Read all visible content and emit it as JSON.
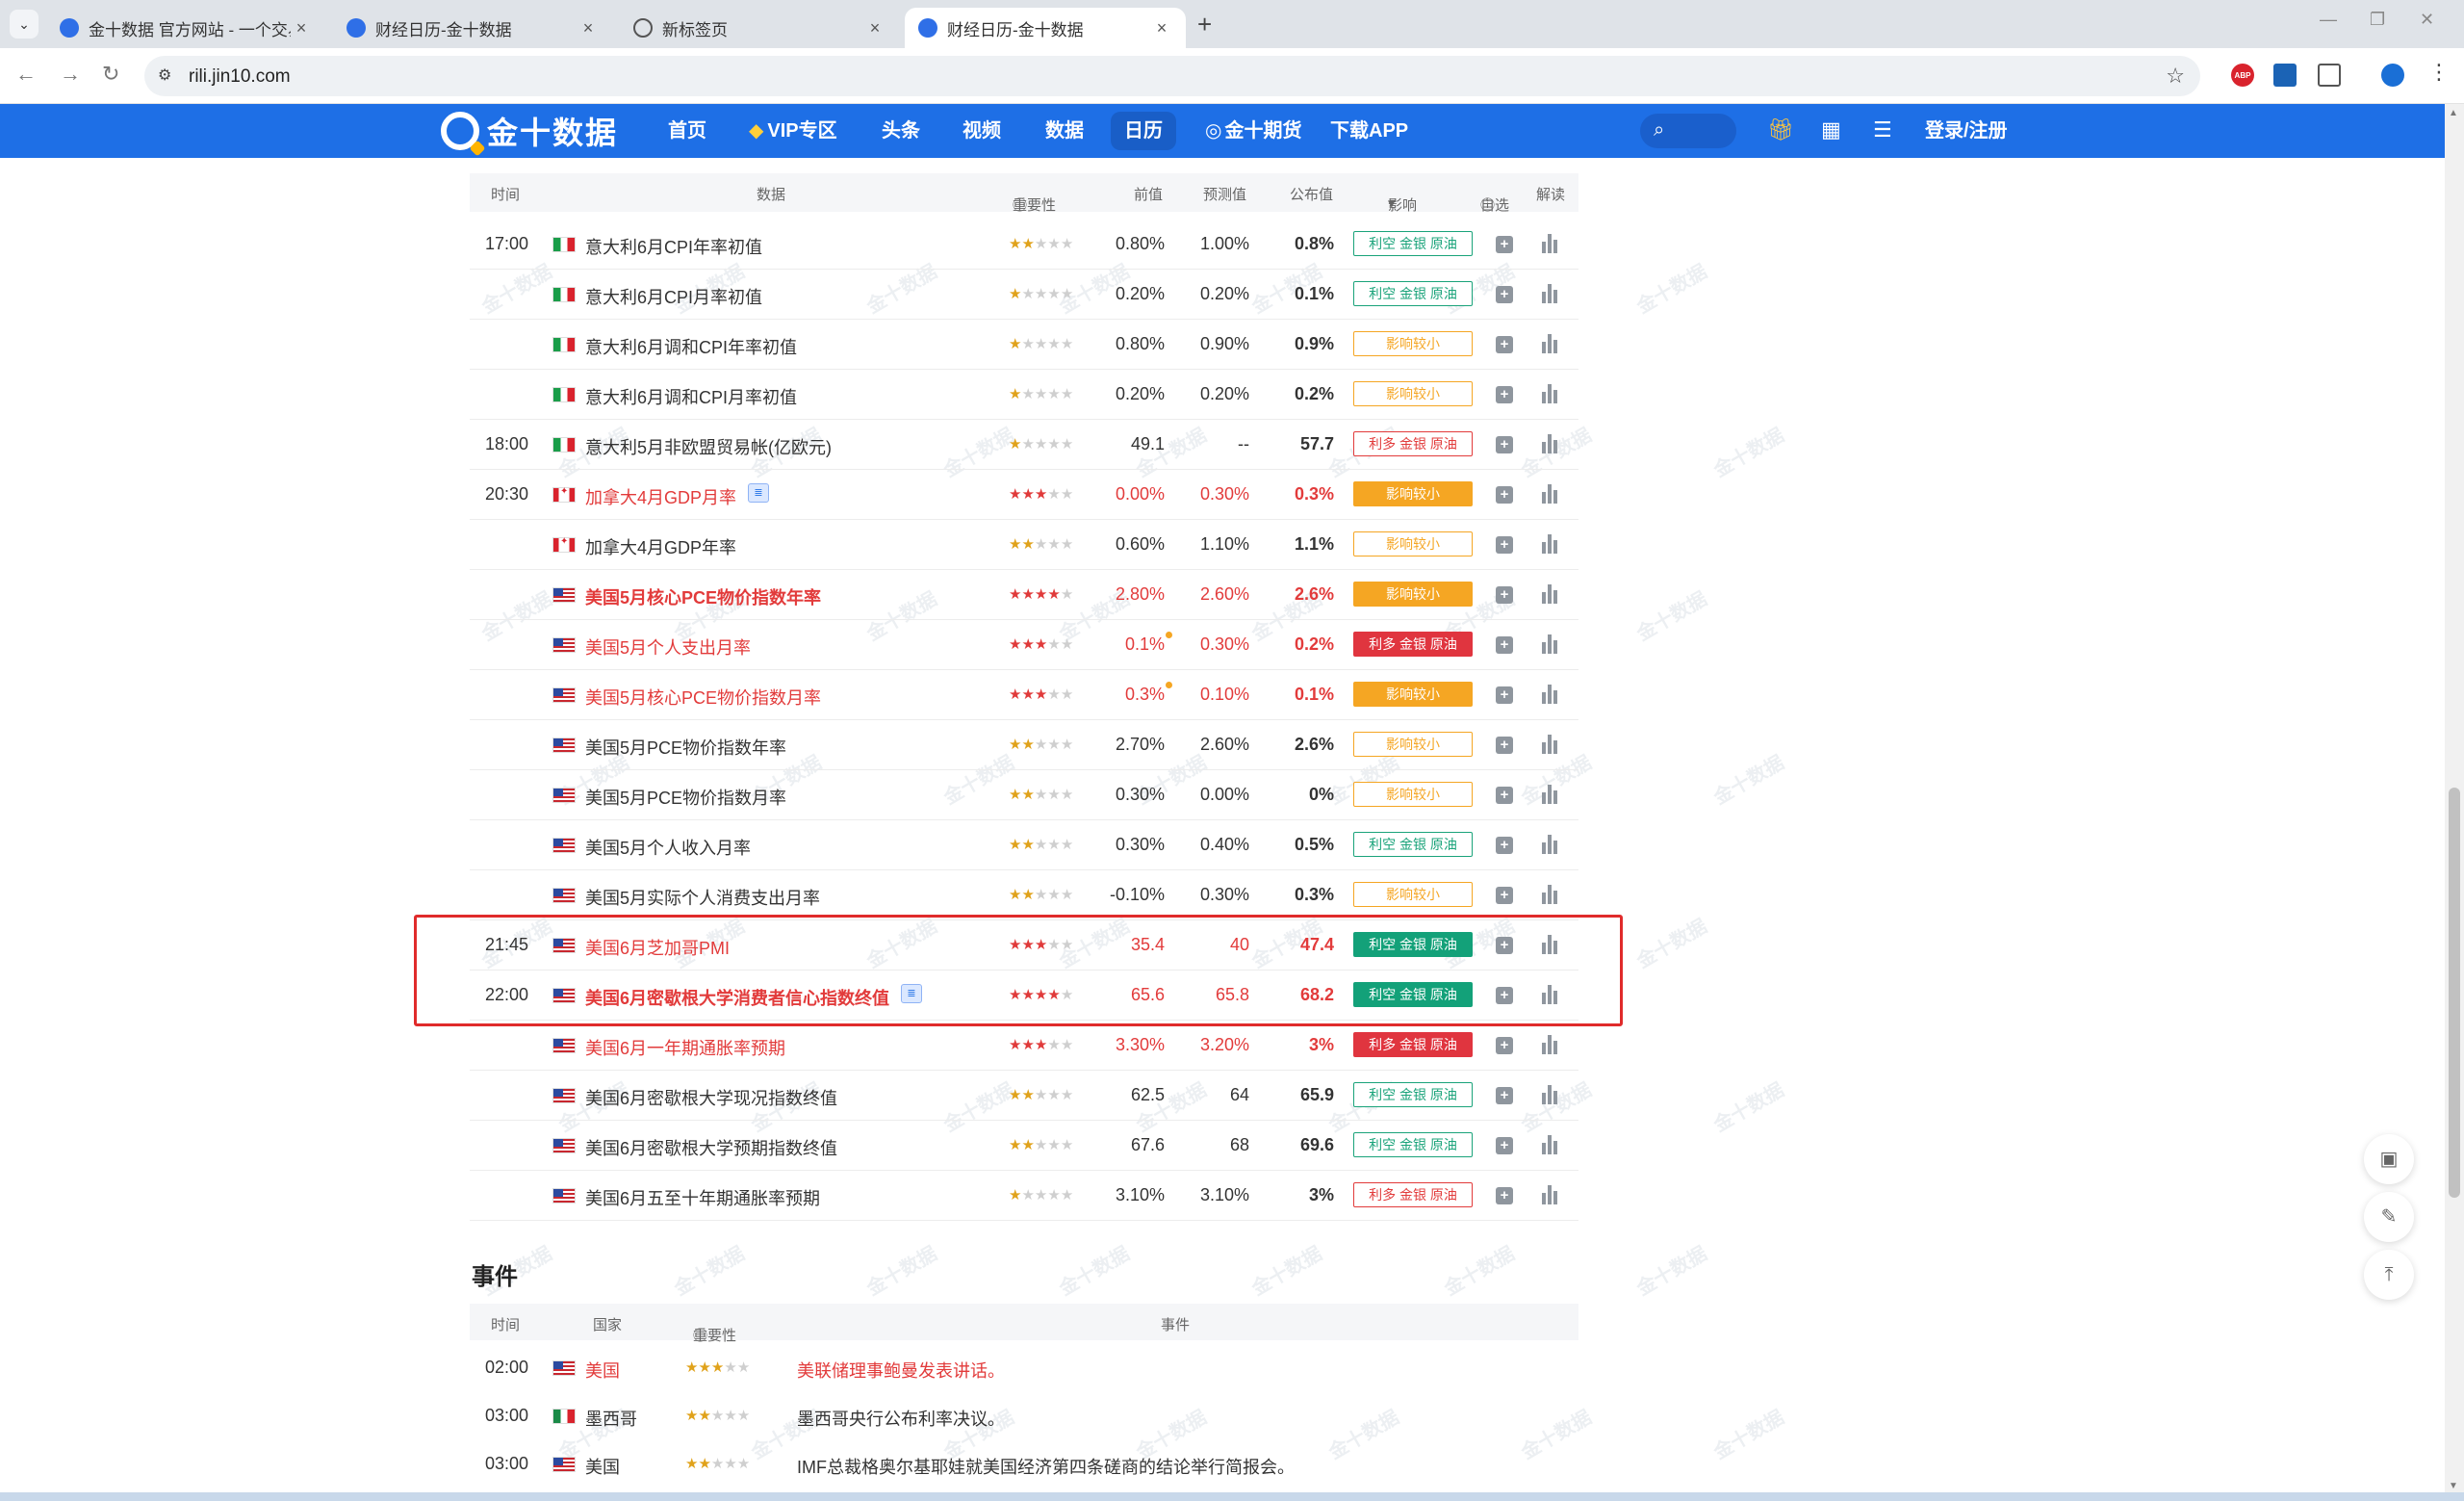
{
  "browser": {
    "tabs": [
      {
        "title": "金十数据 官方网站 - 一个交易工",
        "active": false,
        "icon": "jin10-favicon"
      },
      {
        "title": "财经日历-金十数据",
        "active": false,
        "icon": "jin10-favicon"
      },
      {
        "title": "新标签页",
        "active": false,
        "icon": "globe-icon"
      },
      {
        "title": "财经日历-金十数据",
        "active": true,
        "icon": "jin10-favicon"
      }
    ],
    "url": "rili.jin10.com",
    "abp_label": "ABP"
  },
  "site": {
    "logo_text": "金十数据",
    "nav": [
      "首页",
      "VIP专区",
      "头条",
      "视频",
      "数据",
      "日历",
      "金十期货",
      "下载APP"
    ],
    "active_nav": "日历",
    "login": "登录/注册"
  },
  "table": {
    "headers": {
      "time": "时间",
      "data": "数据",
      "importance": "重要性",
      "prev": "前值",
      "forecast": "预测值",
      "actual": "公布值",
      "impact": "影响",
      "watch": "自选",
      "interpret": "解读"
    },
    "rows": [
      {
        "time": "17:00",
        "flag": "it",
        "name": "意大利6月CPI年率初值",
        "red": false,
        "bold": false,
        "stars": 2,
        "prev": "0.80%",
        "forecast": "1.00%",
        "actual": "0.8%",
        "impact": "利空 金银 原油",
        "impact_style": "neg-o"
      },
      {
        "time": "",
        "flag": "it",
        "name": "意大利6月CPI月率初值",
        "red": false,
        "bold": false,
        "stars": 1,
        "prev": "0.20%",
        "forecast": "0.20%",
        "actual": "0.1%",
        "impact": "利空 金银 原油",
        "impact_style": "neg-o"
      },
      {
        "time": "",
        "flag": "it",
        "name": "意大利6月调和CPI年率初值",
        "red": false,
        "bold": false,
        "stars": 1,
        "prev": "0.80%",
        "forecast": "0.90%",
        "actual": "0.9%",
        "impact": "影响较小",
        "impact_style": "sm-o"
      },
      {
        "time": "",
        "flag": "it",
        "name": "意大利6月调和CPI月率初值",
        "red": false,
        "bold": false,
        "stars": 1,
        "prev": "0.20%",
        "forecast": "0.20%",
        "actual": "0.2%",
        "impact": "影响较小",
        "impact_style": "sm-o"
      },
      {
        "time": "18:00",
        "flag": "it",
        "name": "意大利5月非欧盟贸易帐(亿欧元)",
        "red": false,
        "bold": false,
        "stars": 1,
        "prev": "49.1",
        "forecast": "--",
        "actual": "57.7",
        "impact": "利多 金银 原油",
        "impact_style": "pos-o"
      },
      {
        "time": "20:30",
        "flag": "ca",
        "name": "加拿大4月GDP月率",
        "red": true,
        "bold": false,
        "stars": 3,
        "prev": "0.00%",
        "forecast": "0.30%",
        "actual": "0.3%",
        "impact": "影响较小",
        "impact_style": "sm-s",
        "doc": true
      },
      {
        "time": "",
        "flag": "ca",
        "name": "加拿大4月GDP年率",
        "red": false,
        "bold": false,
        "stars": 2,
        "prev": "0.60%",
        "forecast": "1.10%",
        "actual": "1.1%",
        "impact": "影响较小",
        "impact_style": "sm-o"
      },
      {
        "time": "",
        "flag": "us",
        "name": "美国5月核心PCE物价指数年率",
        "red": true,
        "bold": true,
        "stars": 4,
        "prev": "2.80%",
        "forecast": "2.60%",
        "actual": "2.6%",
        "impact": "影响较小",
        "impact_style": "sm-s"
      },
      {
        "time": "",
        "flag": "us",
        "name": "美国5月个人支出月率",
        "red": true,
        "bold": false,
        "stars": 3,
        "prev": "0.1%",
        "forecast": "0.30%",
        "actual": "0.2%",
        "impact": "利多 金银 原油",
        "impact_style": "pos-s",
        "revised": true
      },
      {
        "time": "",
        "flag": "us",
        "name": "美国5月核心PCE物价指数月率",
        "red": true,
        "bold": false,
        "stars": 3,
        "prev": "0.3%",
        "forecast": "0.10%",
        "actual": "0.1%",
        "impact": "影响较小",
        "impact_style": "sm-s",
        "revised": true
      },
      {
        "time": "",
        "flag": "us",
        "name": "美国5月PCE物价指数年率",
        "red": false,
        "bold": false,
        "stars": 2,
        "prev": "2.70%",
        "forecast": "2.60%",
        "actual": "2.6%",
        "impact": "影响较小",
        "impact_style": "sm-o"
      },
      {
        "time": "",
        "flag": "us",
        "name": "美国5月PCE物价指数月率",
        "red": false,
        "bold": false,
        "stars": 2,
        "prev": "0.30%",
        "forecast": "0.00%",
        "actual": "0%",
        "impact": "影响较小",
        "impact_style": "sm-o"
      },
      {
        "time": "",
        "flag": "us",
        "name": "美国5月个人收入月率",
        "red": false,
        "bold": false,
        "stars": 2,
        "prev": "0.30%",
        "forecast": "0.40%",
        "actual": "0.5%",
        "impact": "利空 金银 原油",
        "impact_style": "neg-o"
      },
      {
        "time": "",
        "flag": "us",
        "name": "美国5月实际个人消费支出月率",
        "red": false,
        "bold": false,
        "stars": 2,
        "prev": "-0.10%",
        "forecast": "0.30%",
        "actual": "0.3%",
        "impact": "影响较小",
        "impact_style": "sm-o"
      },
      {
        "time": "21:45",
        "flag": "us",
        "name": "美国6月芝加哥PMI",
        "red": true,
        "bold": false,
        "stars": 3,
        "prev": "35.4",
        "forecast": "40",
        "actual": "47.4",
        "impact": "利空 金银 原油",
        "impact_style": "neg-s"
      },
      {
        "time": "22:00",
        "flag": "us",
        "name": "美国6月密歇根大学消费者信心指数终值",
        "red": true,
        "bold": true,
        "stars": 4,
        "prev": "65.6",
        "forecast": "65.8",
        "actual": "68.2",
        "impact": "利空 金银 原油",
        "impact_style": "neg-s",
        "doc": true
      },
      {
        "time": "",
        "flag": "us",
        "name": "美国6月一年期通胀率预期",
        "red": true,
        "bold": false,
        "stars": 3,
        "prev": "3.30%",
        "forecast": "3.20%",
        "actual": "3%",
        "impact": "利多 金银 原油",
        "impact_style": "pos-s"
      },
      {
        "time": "",
        "flag": "us",
        "name": "美国6月密歇根大学现况指数终值",
        "red": false,
        "bold": false,
        "stars": 2,
        "prev": "62.5",
        "forecast": "64",
        "actual": "65.9",
        "impact": "利空 金银 原油",
        "impact_style": "neg-o"
      },
      {
        "time": "",
        "flag": "us",
        "name": "美国6月密歇根大学预期指数终值",
        "red": false,
        "bold": false,
        "stars": 2,
        "prev": "67.6",
        "forecast": "68",
        "actual": "69.6",
        "impact": "利空 金银 原油",
        "impact_style": "neg-o"
      },
      {
        "time": "",
        "flag": "us",
        "name": "美国6月五至十年期通胀率预期",
        "red": false,
        "bold": false,
        "stars": 1,
        "prev": "3.10%",
        "forecast": "3.10%",
        "actual": "3%",
        "impact": "利多 金银 原油",
        "impact_style": "pos-o"
      }
    ]
  },
  "events": {
    "title": "事件",
    "headers": {
      "time": "时间",
      "country": "国家",
      "importance": "重要性",
      "event": "事件"
    },
    "rows": [
      {
        "time": "02:00",
        "flag": "us",
        "country": "美国",
        "stars": 3,
        "event": "美联储理事鲍曼发表讲话。",
        "red": true
      },
      {
        "time": "03:00",
        "flag": "mx",
        "country": "墨西哥",
        "stars": 2,
        "event": "墨西哥央行公布利率决议。",
        "red": false
      },
      {
        "time": "03:00",
        "flag": "us",
        "country": "美国",
        "stars": 2,
        "event": "IMF总裁格奥尔基耶娃就美国经济第四条磋商的结论举行简报会。",
        "red": false
      }
    ]
  },
  "watermark_text": "金十数据",
  "colors": {
    "brand": "#1e6fe6",
    "bullish": "#e0353f",
    "bearish": "#13a179",
    "minor": "#f5a623",
    "highlight": "#e02b2b"
  }
}
